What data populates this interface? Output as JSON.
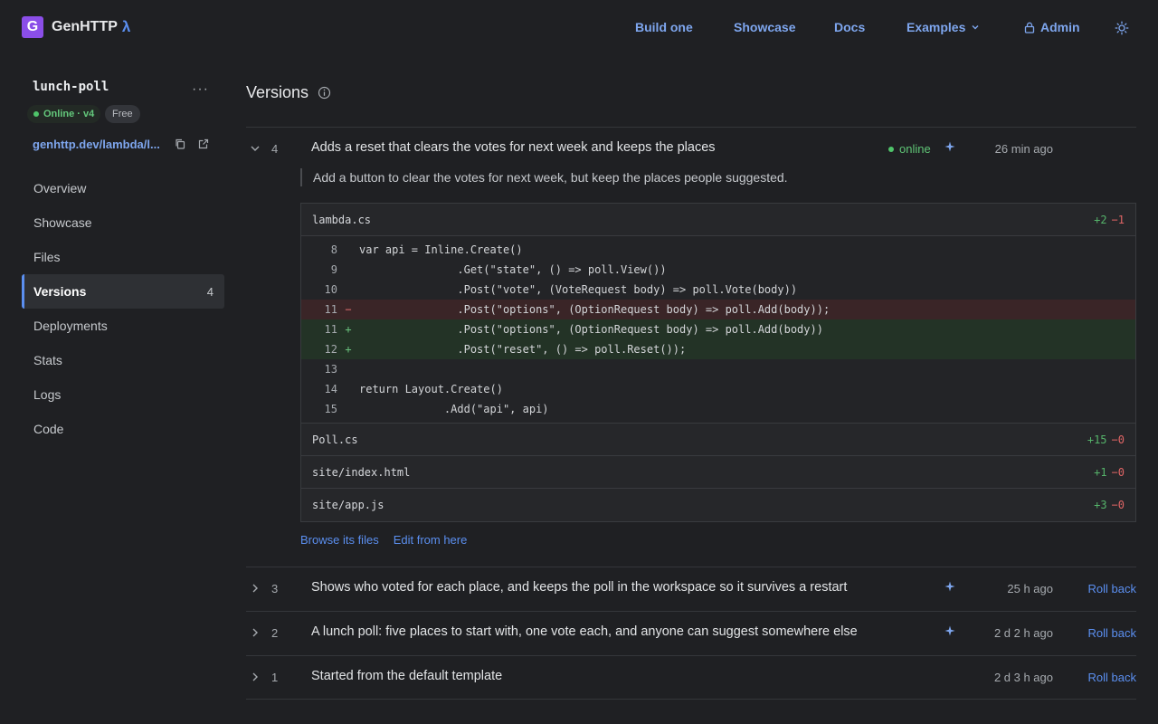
{
  "brand": {
    "logo_letter": "G",
    "name": "GenHTTP",
    "lambda": "λ"
  },
  "nav": {
    "build": "Build one",
    "showcase": "Showcase",
    "docs": "Docs",
    "examples": "Examples",
    "admin": "Admin"
  },
  "project": {
    "name": "lunch-poll",
    "menu_dots": "···",
    "status": "Online · v4",
    "plan": "Free",
    "url": "genhttp.dev/lambda/l..."
  },
  "sidebar": {
    "items": [
      {
        "label": "Overview",
        "count": ""
      },
      {
        "label": "Showcase",
        "count": ""
      },
      {
        "label": "Files",
        "count": ""
      },
      {
        "label": "Versions",
        "count": "4"
      },
      {
        "label": "Deployments",
        "count": ""
      },
      {
        "label": "Stats",
        "count": ""
      },
      {
        "label": "Logs",
        "count": ""
      },
      {
        "label": "Code",
        "count": ""
      }
    ]
  },
  "main": {
    "title": "Versions",
    "versions": [
      {
        "num": "4",
        "message": "Adds a reset that clears the votes for next week and keeps the places",
        "status": "online",
        "time": "26 min ago",
        "description": "Add a button to clear the votes for next week, but keep the places people suggested.",
        "files": [
          {
            "name": "lambda.cs",
            "add": "+2",
            "del": "−1",
            "lines": [
              {
                "ln": "8",
                "sign": "",
                "type": "ctx",
                "text": "var api = Inline.Create()"
              },
              {
                "ln": "9",
                "sign": "",
                "type": "ctx",
                "text": "               .Get(\"state\", () => poll.View())"
              },
              {
                "ln": "10",
                "sign": "",
                "type": "ctx",
                "text": "               .Post(\"vote\", (VoteRequest body) => poll.Vote(body))"
              },
              {
                "ln": "11",
                "sign": "−",
                "type": "del",
                "text": "               .Post(\"options\", (OptionRequest body) => poll.Add(body));"
              },
              {
                "ln": "11",
                "sign": "+",
                "type": "add",
                "text": "               .Post(\"options\", (OptionRequest body) => poll.Add(body))"
              },
              {
                "ln": "12",
                "sign": "+",
                "type": "add",
                "text": "               .Post(\"reset\", () => poll.Reset());"
              },
              {
                "ln": "13",
                "sign": "",
                "type": "ctx",
                "text": ""
              },
              {
                "ln": "14",
                "sign": "",
                "type": "ctx",
                "text": "return Layout.Create()"
              },
              {
                "ln": "15",
                "sign": "",
                "type": "ctx",
                "text": "             .Add(\"api\", api)"
              }
            ]
          },
          {
            "name": "Poll.cs",
            "add": "+15",
            "del": "−0",
            "lines": []
          },
          {
            "name": "site/index.html",
            "add": "+1",
            "del": "−0",
            "lines": []
          },
          {
            "name": "site/app.js",
            "add": "+3",
            "del": "−0",
            "lines": []
          }
        ],
        "links": {
          "browse": "Browse its files",
          "edit": "Edit from here"
        }
      },
      {
        "num": "3",
        "message": "Shows who voted for each place, and keeps the poll in the workspace so it survives a restart",
        "time": "25 h ago",
        "action": "Roll back"
      },
      {
        "num": "2",
        "message": "A lunch poll: five places to start with, one vote each, and anyone can suggest somewhere else",
        "time": "2 d 2 h ago",
        "action": "Roll back"
      },
      {
        "num": "1",
        "message": "Started from the default template",
        "time": "2 d 3 h ago",
        "action": "Roll back"
      }
    ]
  }
}
